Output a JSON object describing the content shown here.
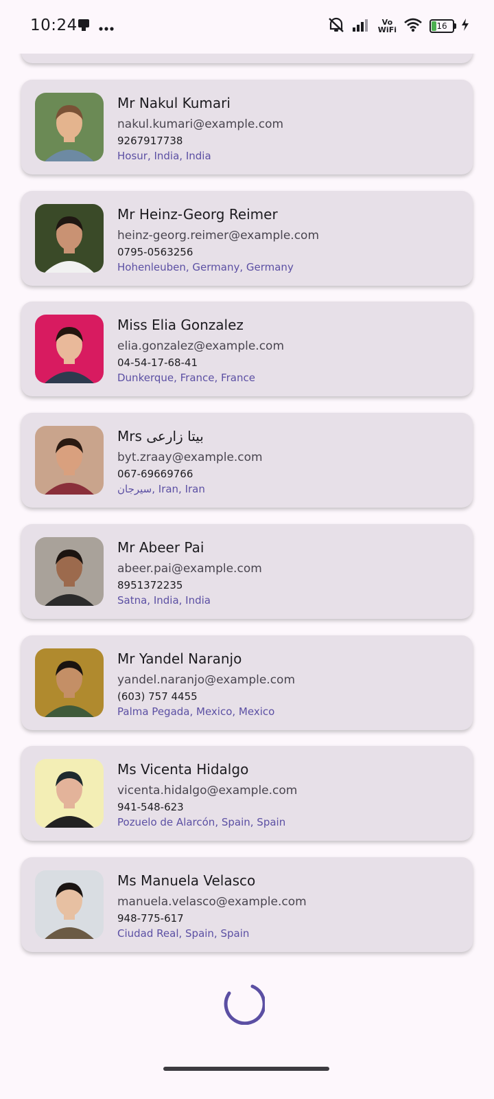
{
  "status_bar": {
    "time": "10:24",
    "icons": [
      "notification-icon",
      "more-dots-icon",
      "mute-icon",
      "signal-icon",
      "vowifi-icon",
      "wifi-icon",
      "battery-icon",
      "charging-icon"
    ],
    "vowifi_top": "Vo",
    "vowifi_bottom": "WiFi",
    "battery": "16"
  },
  "contacts": [
    {
      "name": "Mr Nakul Kumari",
      "email": "nakul.kumari@example.com",
      "phone": "9267917738",
      "location": "Hosur, India, India",
      "avatar_bg": "#6b8a55",
      "skin": "#e4b48e",
      "hair": "#7a5236",
      "shirt": "#6d8aa3"
    },
    {
      "name": "Mr Heinz-Georg Reimer",
      "email": "heinz-georg.reimer@example.com",
      "phone": "0795-0563256",
      "location": "Hohenleuben, Germany, Germany",
      "avatar_bg": "#3a4a28",
      "skin": "#c99273",
      "hair": "#1f1712",
      "shirt": "#f1f1f1"
    },
    {
      "name": "Miss Elia Gonzalez",
      "email": "elia.gonzalez@example.com",
      "phone": "04-54-17-68-41",
      "location": "Dunkerque, France, France",
      "avatar_bg": "#d81b60",
      "skin": "#e9b99a",
      "hair": "#24160f",
      "shirt": "#2e3a4e"
    },
    {
      "name": "Mrs بیتا زارعی",
      "email": "byt.zraay@example.com",
      "phone": "067-69669766",
      "location": "سیرجان, Iran, Iran",
      "avatar_bg": "#c9a48c",
      "skin": "#d9a07e",
      "hair": "#2a1a12",
      "shirt": "#8a2f3a"
    },
    {
      "name": "Mr Abeer Pai",
      "email": "abeer.pai@example.com",
      "phone": "8951372235",
      "location": "Satna, India, India",
      "avatar_bg": "#a9a29a",
      "skin": "#9c6a4d",
      "hair": "#1c1410",
      "shirt": "#2b2b2b"
    },
    {
      "name": "Mr Yandel Naranjo",
      "email": "yandel.naranjo@example.com",
      "phone": "(603) 757 4455",
      "location": "Palma Pegada, Mexico, Mexico",
      "avatar_bg": "#b08a2e",
      "skin": "#c48f66",
      "hair": "#1a1410",
      "shirt": "#3f5a3a"
    },
    {
      "name": "Ms Vicenta Hidalgo",
      "email": "vicenta.hidalgo@example.com",
      "phone": "941-548-623",
      "location": "Pozuelo de Alarcón, Spain, Spain",
      "avatar_bg": "#f3eeb5",
      "skin": "#e3b39a",
      "hair": "#1e2a2e",
      "shirt": "#222222"
    },
    {
      "name": "Ms Manuela Velasco",
      "email": "manuela.velasco@example.com",
      "phone": "948-775-617",
      "location": "Ciudad Real, Spain, Spain",
      "avatar_bg": "#d9dde2",
      "skin": "#e7c0a2",
      "hair": "#1a1412",
      "shirt": "#6b5a44"
    }
  ],
  "colors": {
    "background": "#fdf7fc",
    "card": "#e7e0e8",
    "location_text": "#5b4fa3",
    "spinner": "#5b4fa3"
  },
  "loading": true
}
